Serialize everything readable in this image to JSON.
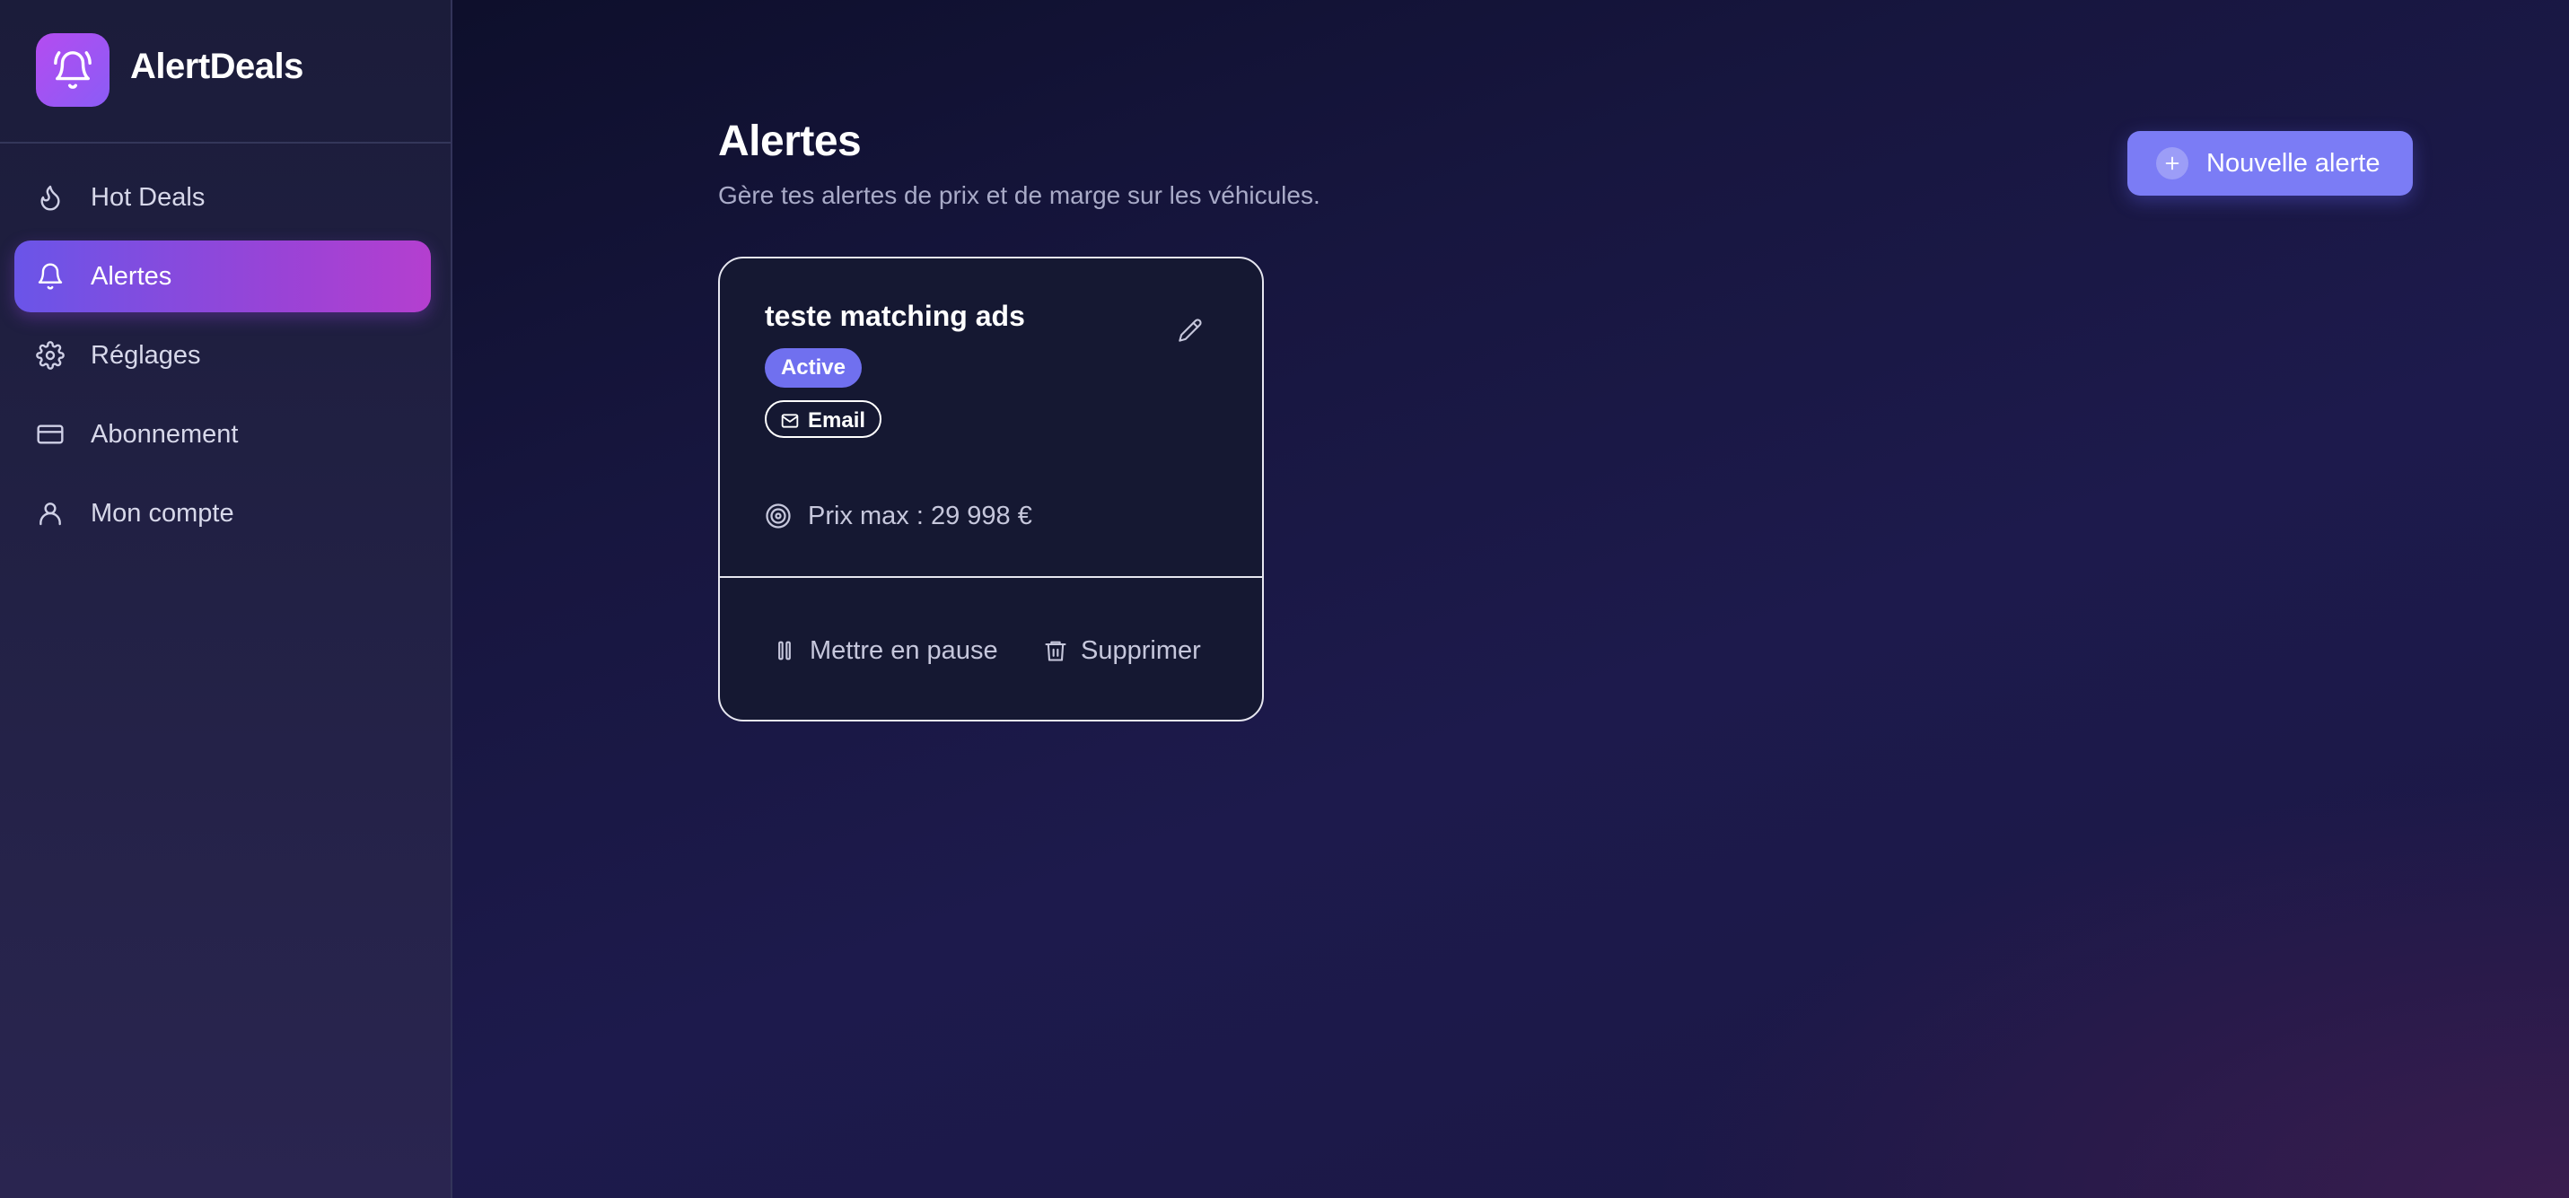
{
  "app": {
    "name": "AlertDeals"
  },
  "colors": {
    "accent": "#7b7cf5",
    "active_nav_start": "#6a55e8",
    "active_nav_end": "#b43fcf",
    "badge_active": "#7070ef"
  },
  "sidebar": {
    "items": [
      {
        "label": "Hot Deals",
        "icon": "flame-icon",
        "active": false
      },
      {
        "label": "Alertes",
        "icon": "bell-icon",
        "active": true
      },
      {
        "label": "Réglages",
        "icon": "gear-icon",
        "active": false
      },
      {
        "label": "Abonnement",
        "icon": "credit-card-icon",
        "active": false
      },
      {
        "label": "Mon compte",
        "icon": "user-icon",
        "active": false
      }
    ]
  },
  "page": {
    "title": "Alertes",
    "subtitle": "Gère tes alertes de prix et de marge sur les véhicules.",
    "new_button_label": "Nouvelle alerte"
  },
  "alerts": [
    {
      "title": "teste matching ads",
      "status": "Active",
      "channel": "Email",
      "price_text": "Prix max : 29 998 €",
      "pause_label": "Mettre en pause",
      "delete_label": "Supprimer"
    }
  ]
}
